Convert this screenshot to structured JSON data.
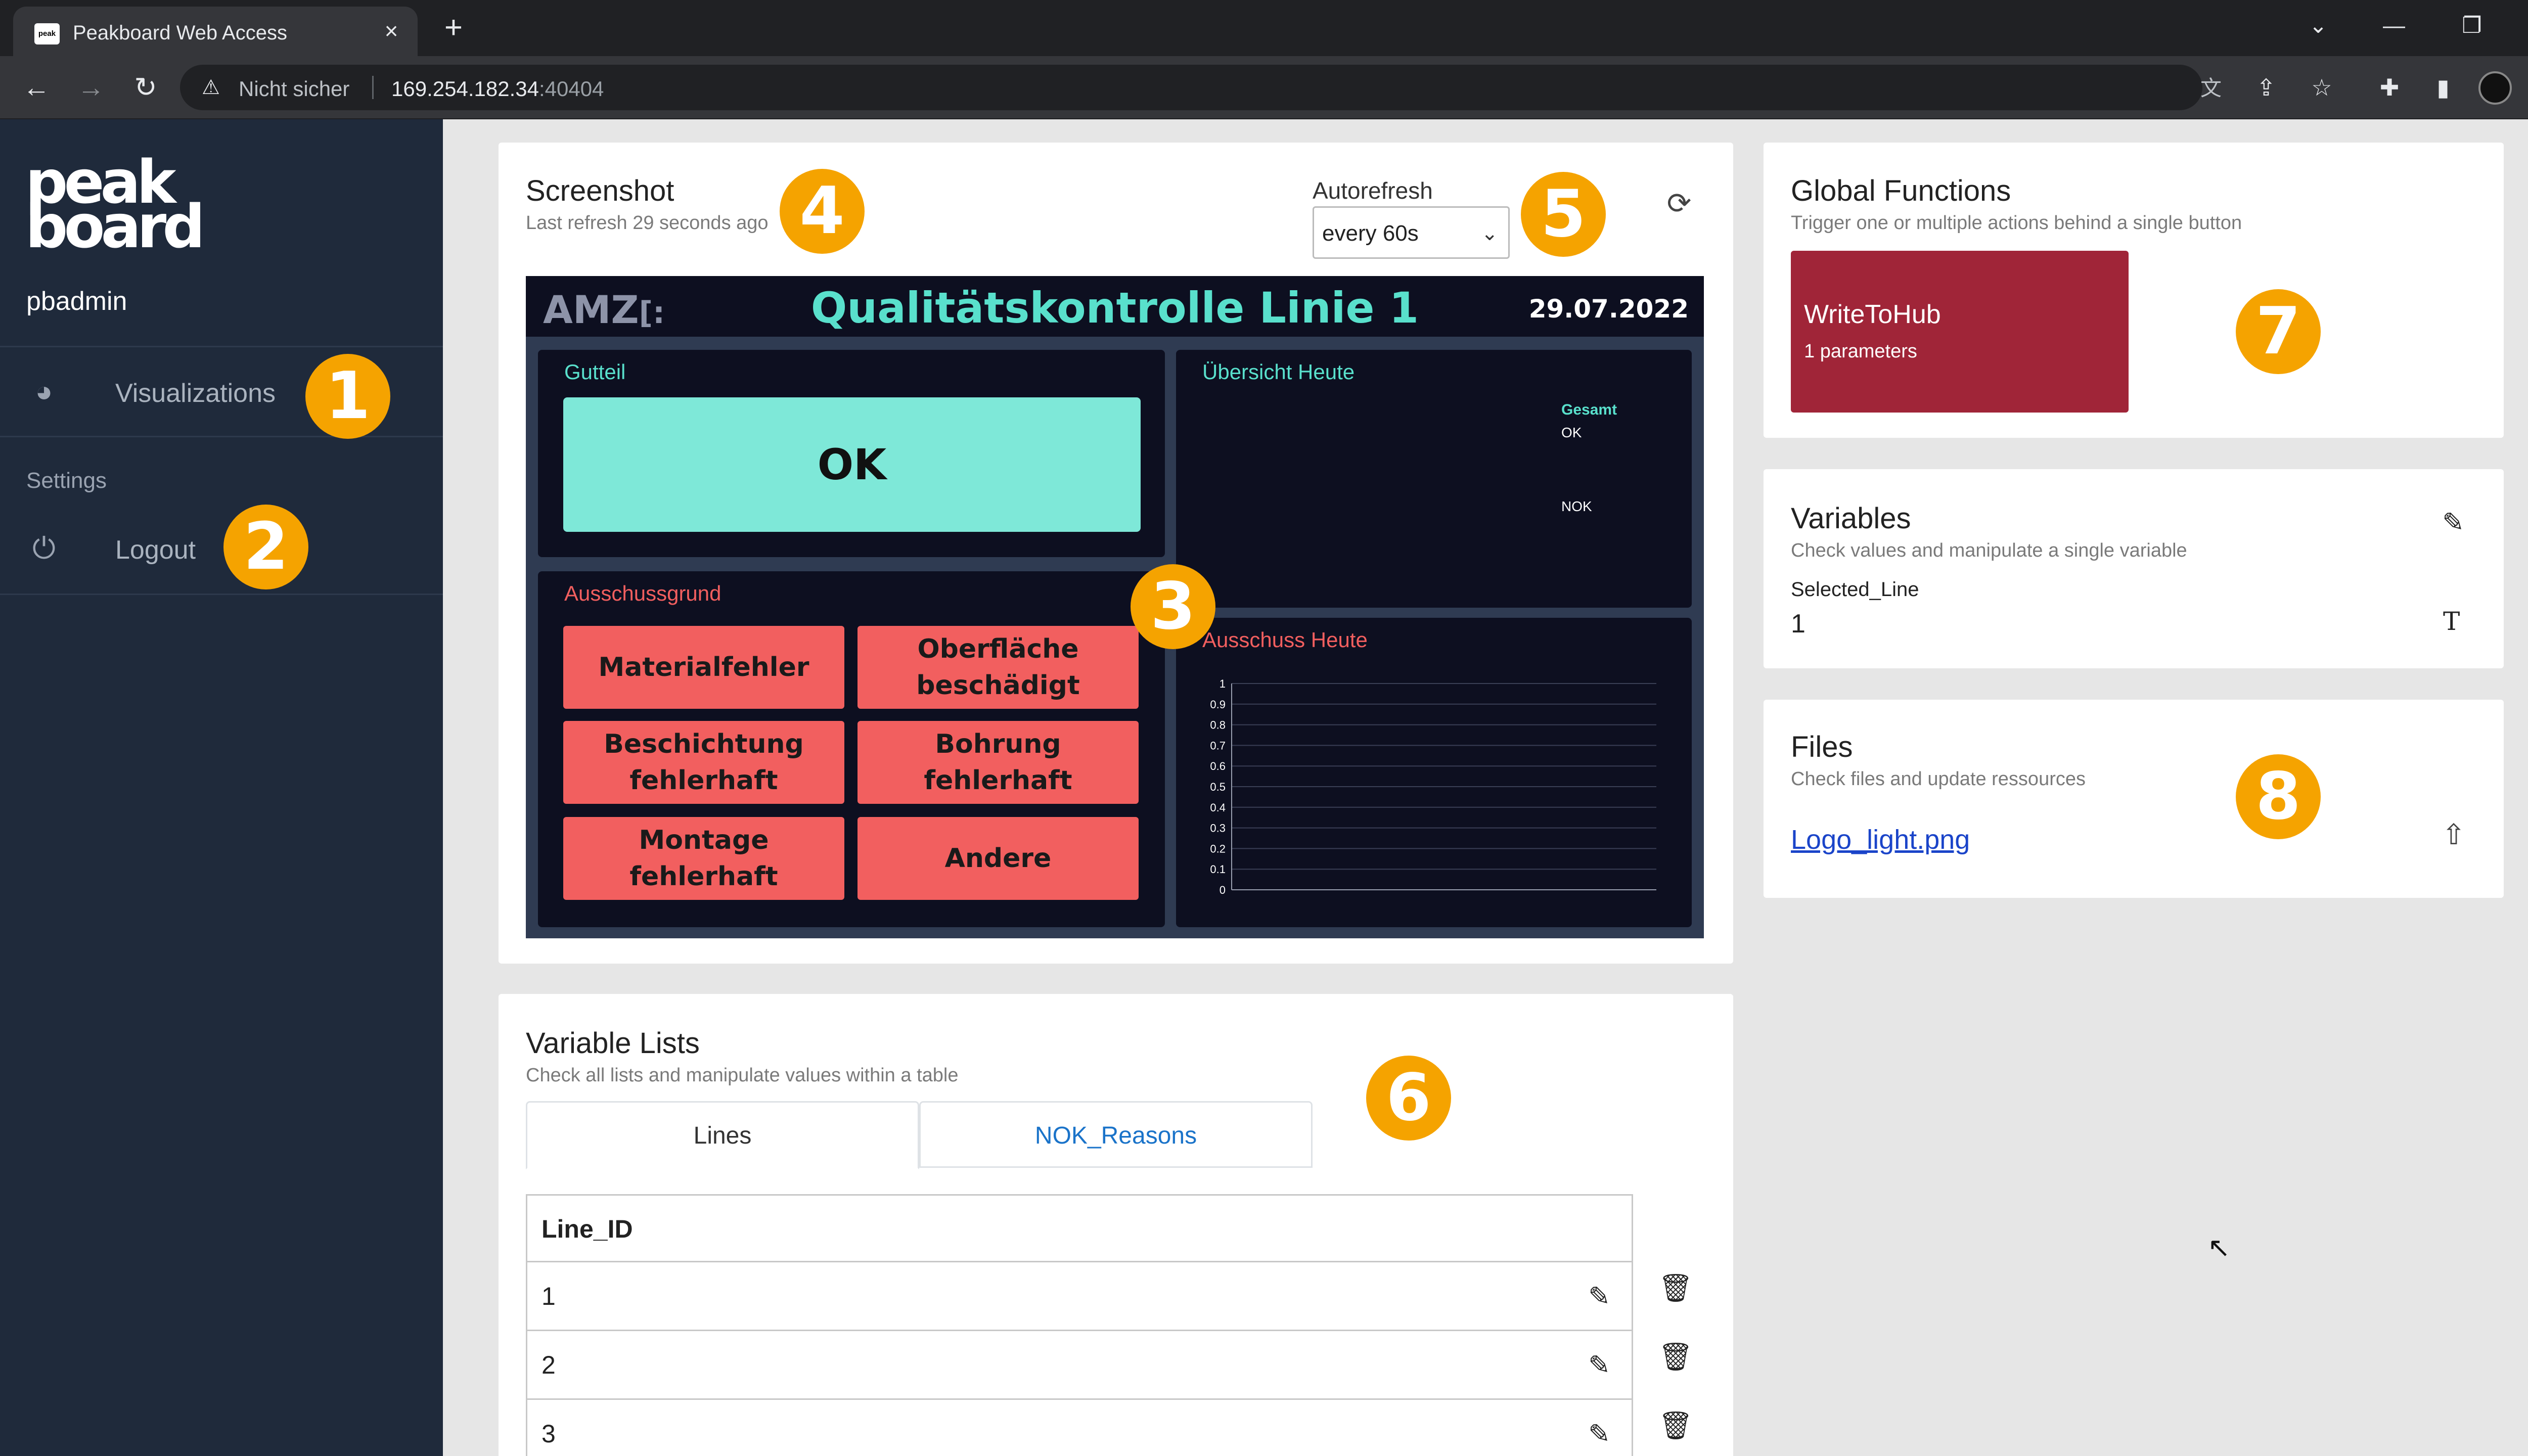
{
  "browser": {
    "tab_title": "Peakboard Web Access",
    "favicon_text": "peak",
    "url_warning": "Nicht sicher",
    "url_host": "169.254.182.34",
    "url_port": ":40404"
  },
  "sidebar": {
    "logo_line1": "peak",
    "logo_line2": "board",
    "username": "pbadmin",
    "items": [
      {
        "label": "Visualizations",
        "icon": "visualization-icon"
      },
      {
        "label": "Logout",
        "icon": "power-icon"
      }
    ],
    "section_settings": "Settings"
  },
  "badges": [
    "1",
    "2",
    "3",
    "4",
    "5",
    "6",
    "7",
    "8"
  ],
  "screenshot_card": {
    "title": "Screenshot",
    "subtitle": "Last refresh 29 seconds ago",
    "autorefresh_label": "Autorefresh",
    "autorefresh_value": "every 60s"
  },
  "dashboard": {
    "logo": "AMZ",
    "title": "Qualitätskontrolle Linie 1",
    "date": "29.07.2022",
    "gutteil_label": "Gutteil",
    "ok_button": "OK",
    "ubersicht_label": "Übersicht Heute",
    "gesamt_label": "Gesamt",
    "ok_label": "OK",
    "nok_label": "NOK",
    "ausschussgrund_label": "Ausschussgrund",
    "ausschuss_label": "Ausschuss Heute",
    "reasons": [
      "Materialfehler",
      "Oberfläche beschädigt",
      "Beschichtung fehlerhaft",
      "Bohrung fehlerhaft",
      "Montage fehlerhaft",
      "Andere"
    ],
    "y_ticks": [
      "1",
      "0.9",
      "0.8",
      "0.7",
      "0.6",
      "0.5",
      "0.4",
      "0.3",
      "0.2",
      "0.1",
      "0"
    ]
  },
  "global_functions": {
    "title": "Global Functions",
    "subtitle": "Trigger one or multiple actions behind a single button",
    "function_name": "WriteToHub",
    "function_params": "1 parameters",
    "color": "#a02538"
  },
  "variables": {
    "title": "Variables",
    "subtitle": "Check values and manipulate a single variable",
    "var_name": "Selected_Line",
    "var_value": "1",
    "type_glyph": "T"
  },
  "files": {
    "title": "Files",
    "subtitle": "Check files and update ressources",
    "file_name": "Logo_light.png"
  },
  "variable_lists": {
    "title": "Variable Lists",
    "subtitle": "Check all lists and manipulate values within a table",
    "tabs": [
      "Lines",
      "NOK_Reasons"
    ],
    "column": "Line_ID",
    "rows": [
      "1",
      "2",
      "3"
    ]
  }
}
